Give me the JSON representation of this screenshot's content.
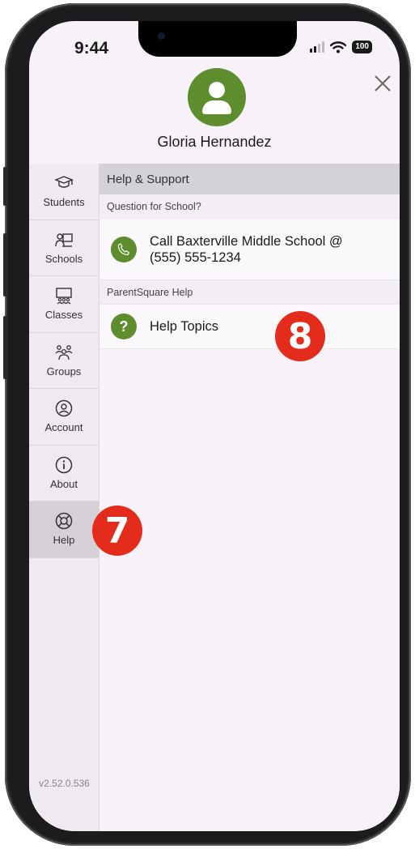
{
  "status_bar": {
    "time": "9:44",
    "battery": "100"
  },
  "profile": {
    "name": "Gloria Hernandez"
  },
  "sidebar": {
    "items": [
      {
        "label": "Students",
        "icon": "graduation-cap-icon"
      },
      {
        "label": "Schools",
        "icon": "school-icon"
      },
      {
        "label": "Classes",
        "icon": "classroom-icon"
      },
      {
        "label": "Groups",
        "icon": "groups-icon"
      },
      {
        "label": "Account",
        "icon": "account-icon"
      },
      {
        "label": "About",
        "icon": "info-icon"
      },
      {
        "label": "Help",
        "icon": "lifebuoy-icon",
        "active": true
      }
    ],
    "version": "v2.52.0.536"
  },
  "content": {
    "header": "Help & Support",
    "sections": [
      {
        "label": "Question for School?",
        "row_line1": "Call Baxterville Middle School @",
        "row_line2": "(555) 555-1234",
        "icon": "phone-icon"
      },
      {
        "label": "ParentSquare Help",
        "row": "Help Topics",
        "icon": "question-icon"
      }
    ]
  },
  "annotations": {
    "step_help": "7",
    "step_topics": "8"
  },
  "colors": {
    "accent_green": "#5d8d2c",
    "badge_red": "#e42c1c",
    "header_bg": "#d4d1d8"
  }
}
